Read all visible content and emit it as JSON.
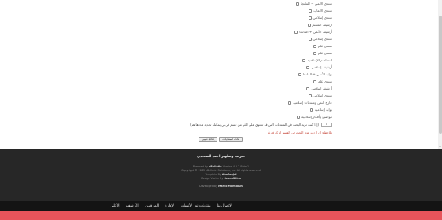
{
  "forums": [
    "منتدى الأنمي + المانجا",
    "منتدى الألعاب",
    "منتدى إسلامي",
    "ارشيف القسم",
    "أرشيف الأنمي + المانجا",
    "منتدى إسلامي",
    "منتدى عام",
    "منتدى عام",
    "التصاميم الإسلامية",
    "أرشيف إسلامي",
    "بوابة الأنمي + المانجا",
    "منتدى عام",
    "أرشيف إسلامي",
    "منتدى إسلامي",
    "خارج النص ومنتديات إسلامية",
    "بوابة إسلامية",
    "مواضيع وأفكار إسلامية"
  ],
  "search_note": "(إذا كنت تريد البحث في المنتديات التي قد تحتوي على أكثر من قسم فرعي يمكنك تحديد عددها هنا)",
  "levels_value": "0",
  "red_note": "ملاحظة: إن اردت عدم البحث في القسم اتركه فارغاً",
  "buttons": {
    "search": "بحث المنتديات",
    "reset": "إعادة تعيين"
  },
  "footer": {
    "title": "تعريب وتطوير احمد الصعيدي",
    "powered_by_label": "Powered by",
    "powered_by_name": "vBulletin",
    "powered_by_version": "Version 4.2.2 Beta 1",
    "copyright": "Copyright © 2013 vBulletin Solutions, Inc. All rights reserved",
    "template_label": "Template By",
    "template_name": "AboAsojdi",
    "design_label": "Design Vector By",
    "design_name": "SevenSkins",
    "developed_label": "Developed By",
    "developed_name": "Marco Mamdouh"
  },
  "nav": [
    "الأعلى",
    "الأرشيف",
    "المراقبين",
    "الإدارة",
    "منتديات نور الأنسات",
    "الاتصال بنا"
  ],
  "colors": {
    "footer_bg": "#272727",
    "nav_bg": "#141414",
    "accent": "#e8545b",
    "note_red": "#c0392b"
  }
}
